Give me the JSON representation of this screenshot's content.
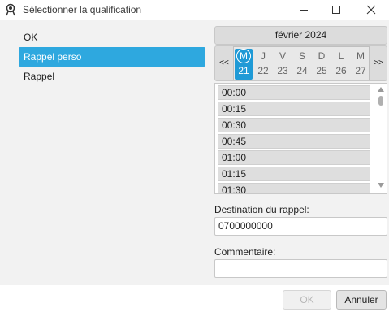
{
  "window": {
    "title": "Sélectionner la qualification",
    "icons": {
      "app": "agent-headset-icon",
      "minimize": "minimize-icon",
      "maximize": "maximize-icon",
      "close": "close-icon"
    }
  },
  "qualifications": [
    {
      "label": "OK",
      "selected": false
    },
    {
      "label": "Rappel perso",
      "selected": true
    },
    {
      "label": "Rappel",
      "selected": false
    }
  ],
  "calendar": {
    "month": "février 2024",
    "prev_label": "<<",
    "next_label": ">>",
    "days": [
      {
        "name": "M",
        "number": "21",
        "selected": true
      },
      {
        "name": "J",
        "number": "22",
        "selected": false
      },
      {
        "name": "V",
        "number": "23",
        "selected": false
      },
      {
        "name": "S",
        "number": "24",
        "selected": false
      },
      {
        "name": "D",
        "number": "25",
        "selected": false
      },
      {
        "name": "L",
        "number": "26",
        "selected": false
      },
      {
        "name": "M",
        "number": "27",
        "selected": false
      }
    ]
  },
  "time_slots": [
    "00:00",
    "00:15",
    "00:30",
    "00:45",
    "01:00",
    "01:15",
    "01:30"
  ],
  "destination": {
    "label": "Destination du rappel:",
    "value": "0700000000"
  },
  "comment": {
    "label": "Commentaire:",
    "value": ""
  },
  "buttons": {
    "ok": "OK",
    "cancel": "Annuler"
  },
  "colors": {
    "accent": "#2ea8df",
    "selected_day": "#1f9ad6",
    "panel": "#f2f2f2"
  }
}
